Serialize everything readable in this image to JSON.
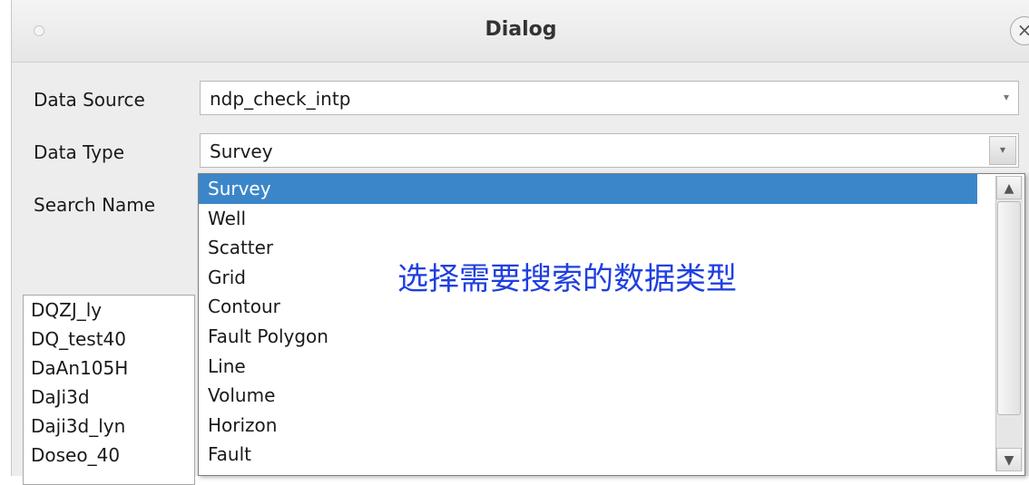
{
  "window": {
    "title": "Dialog",
    "close_glyph": "×"
  },
  "form": {
    "data_source_label": "Data Source",
    "data_source_value": "ndp_check_intp",
    "data_type_label": "Data Type",
    "data_type_value": "Survey",
    "search_name_label": "Search Name",
    "dropdown_arrow_glyph": "▾"
  },
  "dropdown": {
    "options": [
      {
        "label": "Survey",
        "selected": true
      },
      {
        "label": "Well"
      },
      {
        "label": "Scatter"
      },
      {
        "label": "Grid"
      },
      {
        "label": "Contour"
      },
      {
        "label": "Fault Polygon"
      },
      {
        "label": "Line"
      },
      {
        "label": "Volume"
      },
      {
        "label": "Horizon"
      },
      {
        "label": "Fault"
      }
    ],
    "scroll_up_glyph": "▲",
    "scroll_down_glyph": "▼"
  },
  "results_list": {
    "items": [
      "DQZJ_ly",
      "DQ_test40",
      "DaAn105H",
      "DaJi3d",
      "Daji3d_lyn",
      "Doseo_40"
    ]
  },
  "annotation": {
    "text": "选择需要搜索的数据类型",
    "color": "#1f3fe0"
  },
  "colors": {
    "selection": "#3b86c9"
  }
}
